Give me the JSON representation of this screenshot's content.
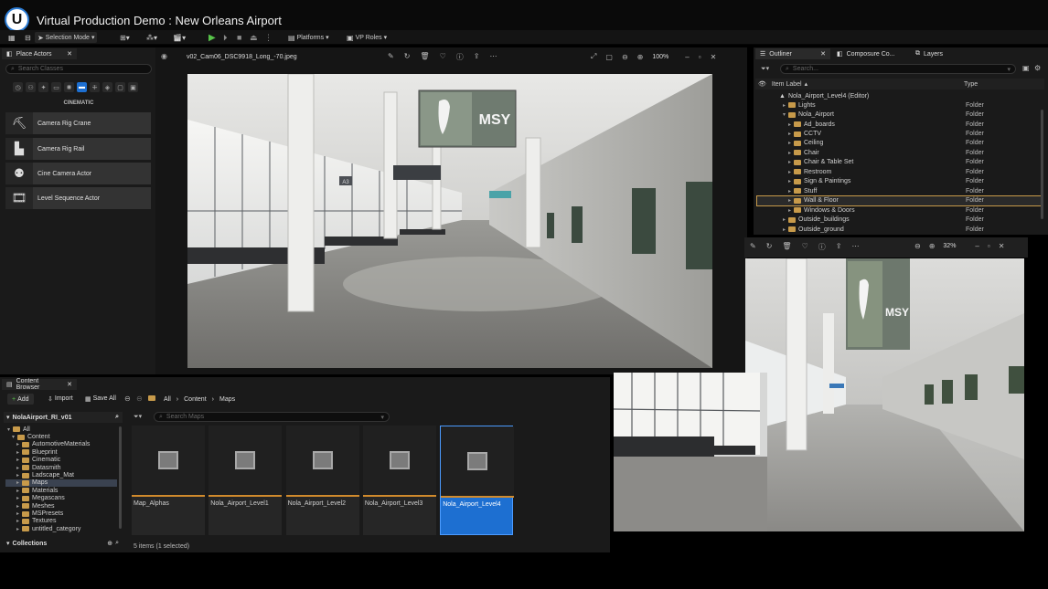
{
  "window": {
    "title": "Virtual Production Demo : New Orleans Airport"
  },
  "toolbar": {
    "selection_mode": "Selection Mode",
    "platforms": "Platforms",
    "vp_roles": "VP Roles"
  },
  "place_actors": {
    "tab": "Place Actors",
    "search_placeholder": "Search Classes",
    "category": "CINEMATIC",
    "items": [
      {
        "label": "Camera Rig Crane",
        "icon": "camera-rig-crane-icon"
      },
      {
        "label": "Camera Rig Rail",
        "icon": "camera-rig-rail-icon"
      },
      {
        "label": "Cine Camera Actor",
        "icon": "cine-camera-icon"
      },
      {
        "label": "Level Sequence Actor",
        "icon": "level-sequence-icon"
      }
    ]
  },
  "viewport": {
    "filename": "v02_Cam06_DSC9918_Long_-70.jpeg",
    "zoom": "100%",
    "sign_text": "MSY",
    "gate_text": "A3"
  },
  "outliner": {
    "tabs": [
      "Outliner",
      "Composure Co...",
      "Layers"
    ],
    "search_placeholder": "Search...",
    "col_label": "Item Label",
    "col_type": "Type",
    "root": "Nola_Airport_Level4 (Editor)",
    "rows": [
      {
        "label": "Lights",
        "type": "Folder",
        "depth": 1,
        "expanded": false
      },
      {
        "label": "Nola_Airport",
        "type": "Folder",
        "depth": 1,
        "expanded": true
      },
      {
        "label": "Ad_boards",
        "type": "Folder",
        "depth": 2,
        "expanded": false
      },
      {
        "label": "CCTV",
        "type": "Folder",
        "depth": 2,
        "expanded": false
      },
      {
        "label": "Ceiling",
        "type": "Folder",
        "depth": 2,
        "expanded": false
      },
      {
        "label": "Chair",
        "type": "Folder",
        "depth": 2,
        "expanded": false
      },
      {
        "label": "Chair & Table Set",
        "type": "Folder",
        "depth": 2,
        "expanded": false
      },
      {
        "label": "Restroom",
        "type": "Folder",
        "depth": 2,
        "expanded": false
      },
      {
        "label": "Sign & Paintings",
        "type": "Folder",
        "depth": 2,
        "expanded": false
      },
      {
        "label": "Stuff",
        "type": "Folder",
        "depth": 2,
        "expanded": false
      },
      {
        "label": "Wall & Floor",
        "type": "Folder",
        "depth": 2,
        "expanded": false,
        "selected": true
      },
      {
        "label": "Windows & Doors",
        "type": "Folder",
        "depth": 2,
        "expanded": false
      },
      {
        "label": "Outside_buildings",
        "type": "Folder",
        "depth": 1,
        "expanded": false
      },
      {
        "label": "Outside_ground",
        "type": "Folder",
        "depth": 1,
        "expanded": false
      }
    ]
  },
  "image2": {
    "zoom": "32%",
    "sign_text": "MSY"
  },
  "content_browser": {
    "tab": "Content Browser",
    "add": "Add",
    "import": "Import",
    "save_all": "Save All",
    "breadcrumb": [
      "All",
      "Content",
      "Maps"
    ],
    "project": "NolaAirport_RI_v01",
    "search_placeholder": "Search Maps",
    "tree": [
      {
        "label": "All",
        "depth": 0
      },
      {
        "label": "Content",
        "depth": 1
      },
      {
        "label": "AutomotiveMaterials",
        "depth": 2
      },
      {
        "label": "Blueprint",
        "depth": 2
      },
      {
        "label": "Cinematic",
        "depth": 2
      },
      {
        "label": "Datasmith",
        "depth": 2
      },
      {
        "label": "Ladscape_Mat",
        "depth": 2
      },
      {
        "label": "Maps",
        "depth": 2,
        "selected": true
      },
      {
        "label": "Materials",
        "depth": 2
      },
      {
        "label": "Megascans",
        "depth": 2
      },
      {
        "label": "Meshes",
        "depth": 2
      },
      {
        "label": "MSPresets",
        "depth": 2
      },
      {
        "label": "Textures",
        "depth": 2
      },
      {
        "label": "untitled_category",
        "depth": 2
      }
    ],
    "assets": [
      {
        "label": "Map_Alphas"
      },
      {
        "label": "Nola_Airport_Level1"
      },
      {
        "label": "Nola_Airport_Level2"
      },
      {
        "label": "Nola_Airport_Level3"
      },
      {
        "label": "Nola_Airport_Level4",
        "selected": true
      }
    ],
    "collections": "Collections",
    "status": "5 items (1 selected)"
  },
  "colors": {
    "accent": "#1d6fd1",
    "folder": "#c79a4a",
    "play": "#58c44a"
  }
}
